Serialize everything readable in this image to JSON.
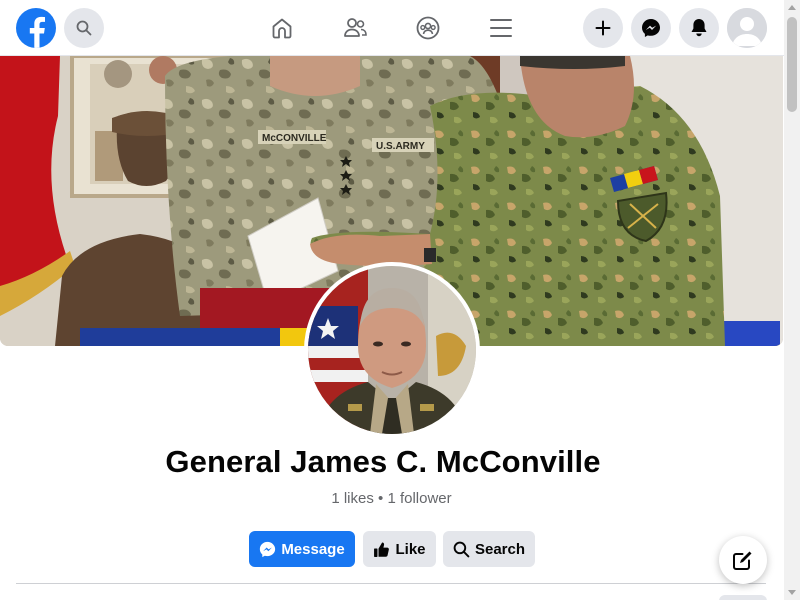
{
  "topbar": {
    "logo_icon": "facebook-logo-icon",
    "search_icon": "search-icon",
    "nav_icons": [
      "home-icon",
      "friends-icon",
      "groups-icon",
      "menu-icon"
    ],
    "right_icons": [
      "plus-icon",
      "messenger-icon",
      "bell-icon",
      "user-avatar-icon"
    ]
  },
  "profile": {
    "name": "General James C. McConville",
    "stats": "1 likes • 1 follower"
  },
  "actions": {
    "message_label": "Message",
    "like_label": "Like",
    "search_label": "Search"
  },
  "cover_text": {
    "nametape_left": "McCONVILLE",
    "usarmy": "U.S.ARMY"
  },
  "colors": {
    "brand_blue": "#1877f2",
    "button_gray": "#e4e6eb",
    "secondary_text": "#65676b"
  }
}
